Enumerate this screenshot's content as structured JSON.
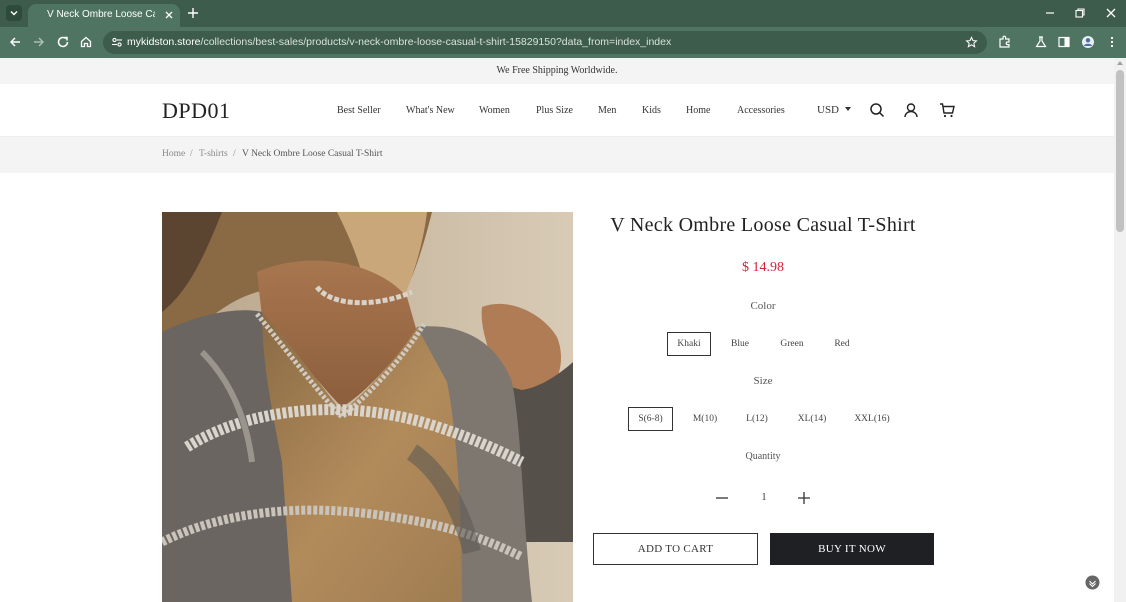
{
  "browser": {
    "tab_title": "V Neck Ombre Loose Casual T-Shirt",
    "url_host": "mykidston.store",
    "url_path": "/collections/best-sales/products/v-neck-ombre-loose-casual-t-shirt-15829150?data_from=index_index",
    "theme_colors": {
      "frame": "#3d5c4b",
      "toolbar": "#507462"
    }
  },
  "announcement": "We Free Shipping Worldwide.",
  "header": {
    "logo": "DPD01",
    "nav": [
      "Best Seller",
      "What's New",
      "Women",
      "Plus Size",
      "Men",
      "Kids",
      "Home",
      "Accessories"
    ],
    "currency": "USD",
    "icons": [
      "search-icon",
      "account-icon",
      "cart-icon"
    ]
  },
  "breadcrumb": {
    "home": "Home",
    "category": "T-shirts",
    "current": "V Neck Ombre Loose Casual T-Shirt",
    "separator": "/"
  },
  "product": {
    "title": "V Neck Ombre Loose Casual T-Shirt",
    "price": "$ 14.98",
    "price_color": "#d0243a",
    "color_label": "Color",
    "colors": [
      "Khaki",
      "Blue",
      "Green",
      "Red"
    ],
    "selected_color": "Khaki",
    "size_label": "Size",
    "sizes": [
      "S(6-8)",
      "M(10)",
      "L(12)",
      "XL(14)",
      "XXL(16)"
    ],
    "selected_size": "S(6-8)",
    "quantity_label": "Quantity",
    "quantity": "1",
    "add_to_cart": "ADD TO CART",
    "buy_now": "BUY IT NOW"
  }
}
